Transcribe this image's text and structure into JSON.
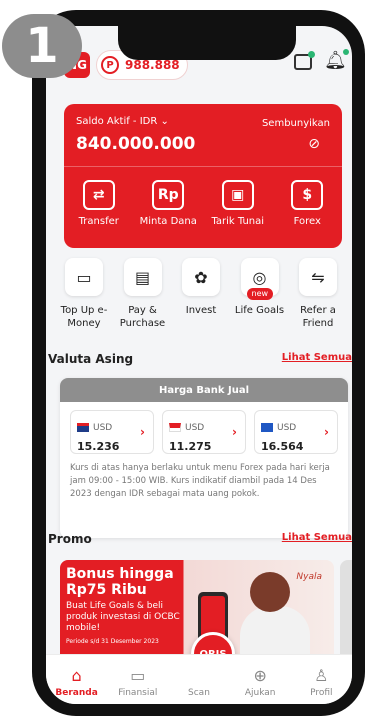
{
  "step_badge": "1",
  "header": {
    "avatar_initials": "NG",
    "points_icon": "P",
    "points_value": "988.888",
    "chat_icon": "chat-icon",
    "bell_icon": "bell-icon"
  },
  "balance": {
    "label": "Saldo Aktif - IDR ⌄",
    "amount": "840.000.000",
    "hide_label": "Sembunyikan",
    "actions": [
      {
        "icon": "⇄",
        "label": "Transfer"
      },
      {
        "icon": "Rp",
        "label": "Minta Dana"
      },
      {
        "icon": "▣",
        "label": "Tarik Tunai"
      },
      {
        "icon": "$",
        "label": "Forex"
      }
    ]
  },
  "quick_menu": [
    {
      "icon": "▭",
      "label": "Top Up e-Money"
    },
    {
      "icon": "▤",
      "label": "Pay & Purchase"
    },
    {
      "icon": "✿",
      "label": "Invest"
    },
    {
      "icon": "◎",
      "label": "Life Goals",
      "badge": "new"
    },
    {
      "icon": "⇋",
      "label": "Refer a Friend"
    }
  ],
  "valuta": {
    "title": "Valuta Asing",
    "link": "Lihat Semua",
    "header": "Harga Bank Jual",
    "rates": [
      {
        "currency": "USD",
        "value": "15.236",
        "flag_color": "#1f3c88"
      },
      {
        "currency": "USD",
        "value": "11.275",
        "flag_color": "#e31e24"
      },
      {
        "currency": "USD",
        "value": "16.564",
        "flag_color": "#1f57c3"
      }
    ],
    "note": "Kurs di atas hanya berlaku untuk menu Forex pada hari kerja jam 09:00 - 15:00 WIB. Kurs indikatif diambil pada 14 Des 2023 dengan IDR sebagai mata uang pokok."
  },
  "promo": {
    "title": "Promo",
    "link": "Lihat Semua",
    "banner_title": "Bonus hingga Rp75 Ribu",
    "banner_sub": "Buat Life Goals & beli produk investasi di OCBC mobile!",
    "banner_period": "Periode s/d 31 Desember 2023",
    "banner_brand": "Nyala"
  },
  "qris_label": "QRIS",
  "bottom_nav": [
    {
      "icon": "⌂",
      "label": "Beranda",
      "active": true
    },
    {
      "icon": "▭",
      "label": "Finansial",
      "active": false
    },
    {
      "icon": "",
      "label": "Scan",
      "active": false
    },
    {
      "icon": "⊕",
      "label": "Ajukan",
      "active": false
    },
    {
      "icon": "♙",
      "label": "Profil",
      "active": false
    }
  ],
  "colors": {
    "brand": "#e31e24",
    "accent_green": "#2bb673"
  }
}
